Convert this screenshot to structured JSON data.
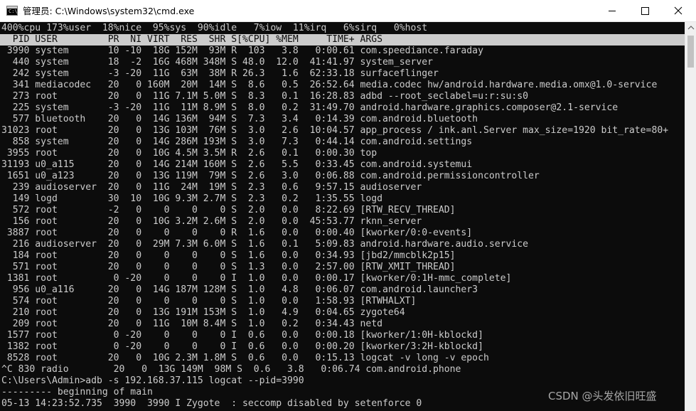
{
  "window": {
    "title": "管理员: C:\\Windows\\system32\\cmd.exe",
    "icon": "cmd-icon",
    "icon_glyph": "C:\\_",
    "controls": [
      "minimize-icon",
      "maximize-icon",
      "close-icon"
    ]
  },
  "colors": {
    "console_bg": "#0c0c0c",
    "console_fg": "#cccccc",
    "header_bg": "#cccccc",
    "titlebar_bg": "#ffffff",
    "scrollbar_bg": "#f0f0f0",
    "scroll_thumb": "#c2c2c2"
  },
  "console": {
    "summary": "400%cpu 173%user  18%nice  95%sys  90%idle   7%iow  11%irq   6%sirq   0%host",
    "header": "  PID USER         PR  NI VIRT  RES  SHR S[%CPU] %MEM     TIME+ ARGS",
    "processes": [
      " 3990 system       10 -10  18G 152M  93M R  103   3.8   0:00.61 com.speediance.faraday",
      "  440 system       18  -2  16G 468M 348M S 48.0  12.0  41:41.97 system_server",
      "  242 system       -3 -20  11G  63M  38M R 26.3   1.6  62:33.18 surfaceflinger",
      "  341 mediacodec   20   0 160M  20M  14M S  8.6   0.5  26:52.64 media.codec hw/android.hardware.media.omx@1.0-service",
      "  273 root         20   0  11G 7.1M 5.0M S  8.3   0.1  16:28.83 adbd --root_seclabel=u:r:su:s0",
      "  225 system       -3 -20  11G  11M 8.9M S  8.0   0.2  31:49.70 android.hardware.graphics.composer@2.1-service",
      "  577 bluetooth    20   0  14G 136M  94M S  7.3   3.4   0:14.39 com.android.bluetooth",
      "31023 root         20   0  13G 103M  76M S  3.0   2.6  10:04.57 app_process / ink.anl.Server max_size=1920 bit_rate=80+",
      "  858 system       20   0  14G 286M 193M S  3.0   7.3   0:44.14 com.android.settings",
      " 3955 root         20   0  10G 4.5M 3.5M R  2.6   0.1   0:00.30 top",
      "31193 u0_a115      20   0  14G 214M 160M S  2.6   5.5   0:33.45 com.android.systemui",
      " 1651 u0_a123      20   0  13G 119M  79M S  2.6   3.0   0:06.88 com.android.permissioncontroller",
      "  239 audioserver  20   0  11G  24M  19M S  2.3   0.6   9:57.15 audioserver",
      "  149 logd         30  10  10G 9.3M 2.7M S  2.3   0.2   1:35.55 logd",
      "  572 root         -2   0    0    0    0 S  2.0   0.0   8:22.69 [RTW_RECV_THREAD]",
      "  156 root         20   0  10G 3.2M 2.6M S  2.0   0.0  45:53.77 rknn_server",
      " 3887 root         20   0    0    0    0 R  1.6   0.0   0:00.40 [kworker/0:0-events]",
      "  216 audioserver  20   0  29M 7.3M 6.0M S  1.6   0.1   5:09.83 android.hardware.audio.service",
      "  184 root         20   0    0    0    0 S  1.6   0.0   0:34.93 [jbd2/mmcblk2p15]",
      "  571 root         20   0    0    0    0 S  1.3   0.0   2:57.00 [RTW_XMIT_THREAD]",
      " 1381 root          0 -20    0    0    0 I  1.0   0.0   0:00.17 [kworker/0:1H-mmc_complete]",
      "  956 u0_a116      20   0  14G 187M 128M S  1.0   4.8   0:06.07 com.android.launcher3",
      "  574 root         20   0    0    0    0 S  1.0   0.0   1:58.93 [RTWHALXT]",
      "  210 root         20   0  13G 191M 153M S  1.0   4.9   0:04.65 zygote64",
      "  209 root         20   0  11G  10M 8.4M S  1.0   0.2   0:34.43 netd",
      " 1577 root          0 -20    0    0    0 I  0.6   0.0   0:00.18 [kworker/1:0H-kblockd]",
      " 1382 root          0 -20    0    0    0 I  0.6   0.0   0:00.20 [kworker/3:2H-kblockd]",
      " 8528 root         20   0  10G 2.3M 1.8M S  0.6   0.0   0:15.13 logcat -v long -v epoch",
      "^C 830 radio        20   0  13G 149M  98M S  0.6   3.8   0:06.74 com.android.phone"
    ],
    "prompt_line": "C:\\Users\\Admin>adb -s 192.168.37.115 logcat --pid=3990",
    "logcat_begin": "--------- beginning of main",
    "logcat_line": "05-13 14:23:52.735  3990  3990 I Zygote  : seccomp disabled by setenforce 0"
  },
  "watermark": "CSDN @头发依旧旺盛"
}
